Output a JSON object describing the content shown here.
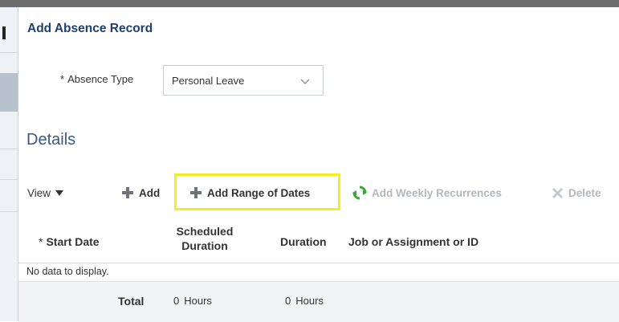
{
  "dialog": {
    "title": "Add Absence Record"
  },
  "absence_type": {
    "required_mark": "*",
    "label": "Absence Type",
    "selected": "Personal Leave"
  },
  "details": {
    "title": "Details"
  },
  "toolbar": {
    "view_label": "View",
    "add_label": "Add",
    "add_range_label": "Add Range of Dates",
    "weekly_label": "Add Weekly Recurrences",
    "delete_label": "Delete",
    "highlight_color": "#f2ee1f",
    "add_icon_color": "#6e7379",
    "recur_icon_color": "#3aa93a"
  },
  "table": {
    "columns": {
      "start_date_required": "*",
      "start_date": "Start Date",
      "scheduled_duration": "Scheduled Duration",
      "duration": "Duration",
      "job": "Job or Assignment or ID"
    },
    "empty_text": "No data to display.",
    "total": {
      "label": "Total",
      "scheduled_value": "0",
      "scheduled_unit": "Hours",
      "duration_value": "0",
      "duration_unit": "Hours"
    }
  }
}
